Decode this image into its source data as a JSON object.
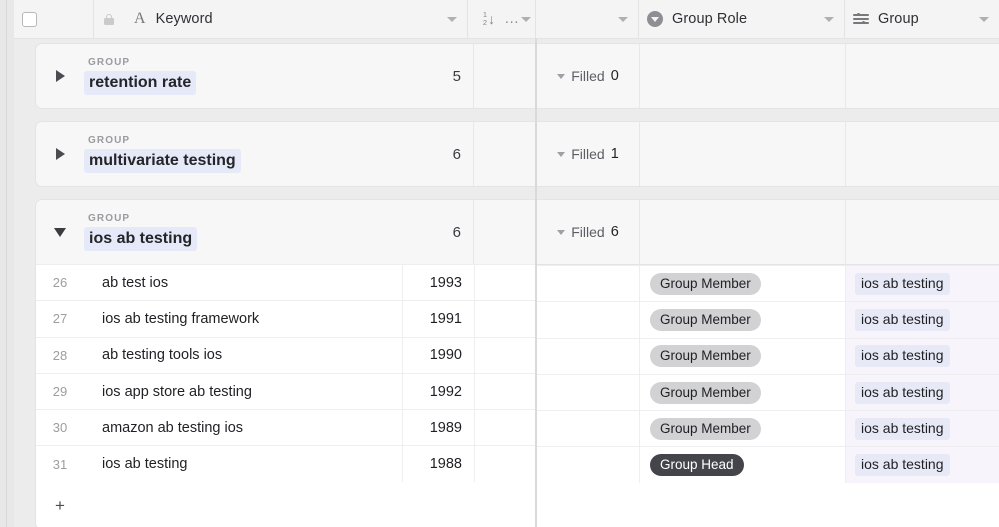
{
  "header": {
    "columns": [
      {
        "label": "Keyword",
        "icon": "text-type-icon",
        "has_lock": true,
        "has_caret": true
      },
      {
        "label": "",
        "icon": "sort-number-icon",
        "menu": "…",
        "has_caret": true
      },
      {
        "label": "",
        "icon": "",
        "has_caret": true
      },
      {
        "label": "Group Role",
        "icon": "single-select-icon",
        "has_caret": true
      },
      {
        "label": "Group",
        "icon": "relation-icon",
        "has_caret": true
      }
    ]
  },
  "groups": [
    {
      "kicker": "GROUP",
      "name": "retention rate",
      "count": "5",
      "expanded": false,
      "filled_label": "Filled",
      "filled_count": "0",
      "rows": []
    },
    {
      "kicker": "GROUP",
      "name": "multivariate testing",
      "count": "6",
      "expanded": false,
      "filled_label": "Filled",
      "filled_count": "1",
      "rows": []
    },
    {
      "kicker": "GROUP",
      "name": "ios ab testing",
      "count": "6",
      "expanded": true,
      "filled_label": "Filled",
      "filled_count": "6",
      "rows": [
        {
          "index": "26",
          "keyword": "ab test ios",
          "number": "1993",
          "role": "Group Member",
          "role_style": "member",
          "group": "ios ab testing"
        },
        {
          "index": "27",
          "keyword": "ios ab testing framework",
          "number": "1991",
          "role": "Group Member",
          "role_style": "member",
          "group": "ios ab testing"
        },
        {
          "index": "28",
          "keyword": "ab testing tools ios",
          "number": "1990",
          "role": "Group Member",
          "role_style": "member",
          "group": "ios ab testing"
        },
        {
          "index": "29",
          "keyword": "ios app store ab testing",
          "number": "1992",
          "role": "Group Member",
          "role_style": "member",
          "group": "ios ab testing"
        },
        {
          "index": "30",
          "keyword": "amazon ab testing ios",
          "number": "1989",
          "role": "Group Member",
          "role_style": "member",
          "group": "ios ab testing"
        },
        {
          "index": "31",
          "keyword": "ios ab testing",
          "number": "1988",
          "role": "Group Head",
          "role_style": "head",
          "group": "ios ab testing"
        }
      ],
      "add_row_label": "+"
    }
  ],
  "colors": {
    "group_name_highlight": "#e6eaf8",
    "group_chip": "#e7eaf6",
    "group_column_tint": "#f7f5fb",
    "badge_member": "#d2d2d4",
    "badge_head": "#44454a",
    "panel_bg": "#ececed",
    "header_bg": "#f4f4f5"
  }
}
